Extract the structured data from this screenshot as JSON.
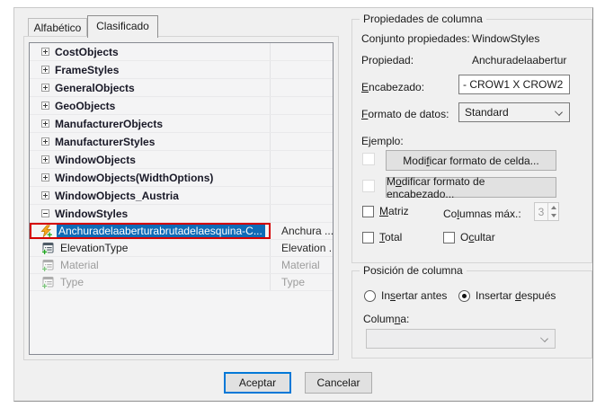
{
  "tabs": {
    "alfabetico": "Alfabético",
    "clasificado": "Clasificado"
  },
  "tree": {
    "categories": [
      "CostObjects",
      "FrameStyles",
      "GeneralObjects",
      "GeoObjects",
      "ManufacturerObjects",
      "ManufacturerStyles",
      "WindowObjects",
      "WindowObjects(WidthOptions)",
      "WindowObjects_Austria"
    ],
    "expanded_category": "WindowStyles",
    "children": [
      {
        "label": "Anchuradelaaberturabrutadelaesquina-C...",
        "value": "Anchura ...",
        "state": "selected"
      },
      {
        "label": "ElevationType",
        "value": "Elevation ...",
        "state": "normal"
      },
      {
        "label": "Material",
        "value": "Material",
        "state": "disabled"
      },
      {
        "label": "Type",
        "value": "Type",
        "state": "disabled"
      }
    ]
  },
  "properties_group": {
    "title": "Propiedades de columna",
    "conjunto_label": "Conjunto propiedades:",
    "conjunto_value": "WindowStyles",
    "propiedad_label": "Propiedad:",
    "propiedad_value": "Anchuradelaabertur",
    "encabezado_label": {
      "pre": "",
      "u": "E",
      "post": "ncabezado:"
    },
    "encabezado_value": "- CROW1 X CROW2",
    "formato_label": {
      "pre": "",
      "u": "F",
      "post": "ormato de datos:"
    },
    "formato_value": "Standard",
    "ejemplo_label": "Ejemplo:",
    "btn_celda": {
      "pre": "Modi",
      "u": "f",
      "post": "icar formato de celda..."
    },
    "btn_encabezado": {
      "pre": "M",
      "u": "o",
      "post": "dificar formato de encabezado..."
    },
    "matriz": {
      "pre": "",
      "u": "M",
      "post": "atriz"
    },
    "columnas_max": {
      "pre": "Co",
      "u": "l",
      "post": "umnas máx.:"
    },
    "columnas_value": "3",
    "total": {
      "pre": "",
      "u": "T",
      "post": "otal"
    },
    "ocultar": {
      "pre": "O",
      "u": "c",
      "post": "ultar"
    }
  },
  "position_group": {
    "title": "Posición de columna",
    "radio_antes": {
      "pre": "In",
      "u": "s",
      "post": "ertar antes"
    },
    "radio_despues": {
      "pre": "Insertar ",
      "u": "d",
      "post": "espués"
    },
    "columna_label": {
      "pre": "Colum",
      "u": "n",
      "post": "a:"
    }
  },
  "buttons": {
    "aceptar": "Aceptar",
    "cancelar": "Cancelar"
  },
  "colors": {
    "selection_blue": "#0f6bb7",
    "highlight_red": "#d40000",
    "default_button_border": "#0078d7",
    "bolt_orange": "#f6a51c",
    "plus_green": "#22a522",
    "disabled_text": "#9c9c9c"
  }
}
